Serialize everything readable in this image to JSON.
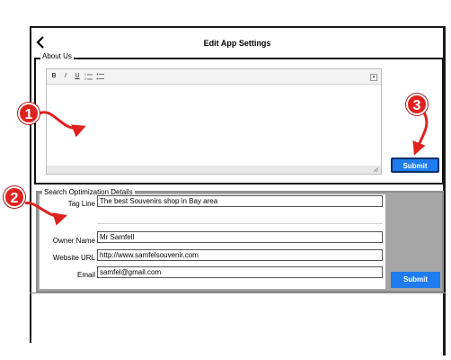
{
  "header": {
    "title": "Edit App Settings",
    "back_icon": "chevron-left-icon"
  },
  "about_us": {
    "legend": "About Us",
    "toolbar": [
      "B",
      "I",
      "U",
      "ordered-list-icon",
      "unordered-list-icon"
    ],
    "submit_label": "Submit"
  },
  "seo": {
    "legend": "Search Optimization Details",
    "fields": [
      {
        "label": "Tag Line",
        "value": "The best Souvenirs shop in Bay area"
      },
      {
        "label": "Owner Name",
        "value": "Mr Samfell"
      },
      {
        "label": "Website URL",
        "value": "http://www.samfelsouvenir.com"
      },
      {
        "label": "Email",
        "value": "samfel@gmail.com"
      }
    ],
    "submit_label": "Submit"
  },
  "annotations": {
    "marker_1": "1",
    "marker_2": "2",
    "marker_3": "3"
  },
  "colors": {
    "accent": "#1e7cf0",
    "marker": "#e0221f",
    "seo_background": "#a6a6a6"
  }
}
